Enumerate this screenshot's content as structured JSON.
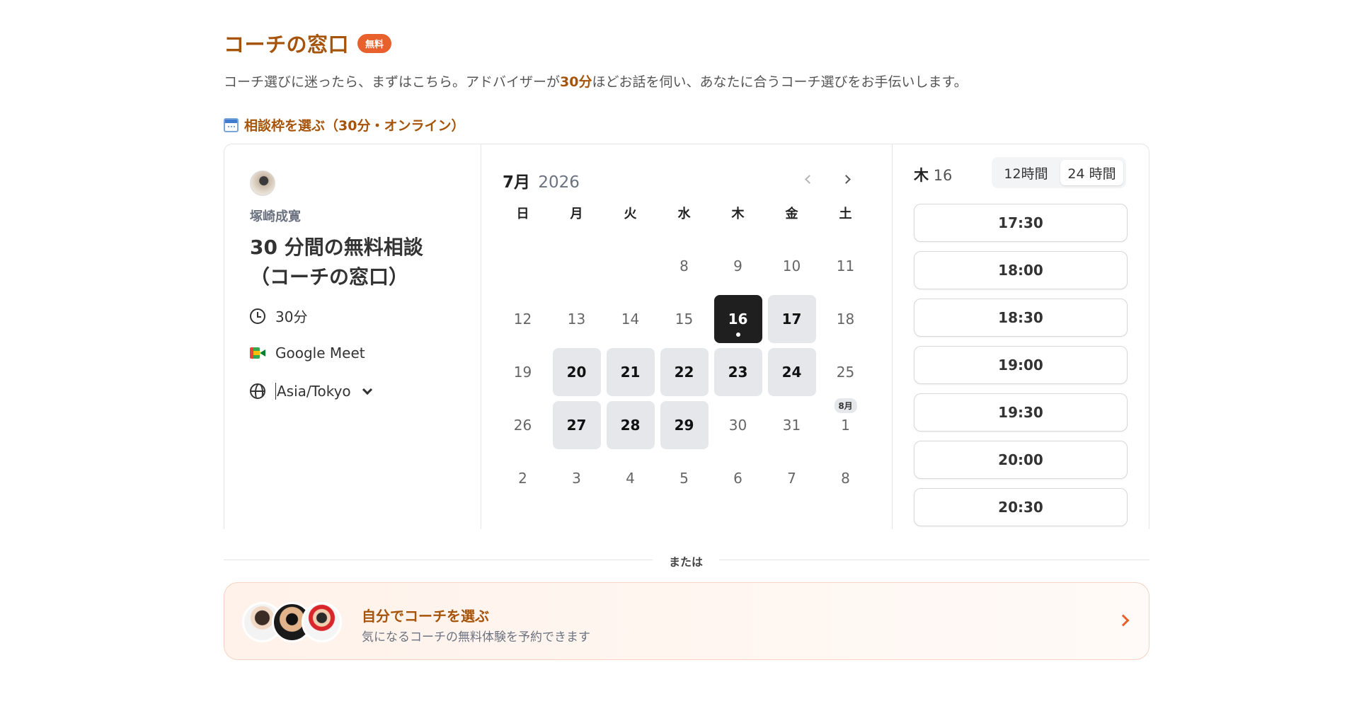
{
  "header": {
    "title": "コーチの窓口",
    "badge": "無料",
    "lead_before": "コーチ選びに迷ったら、まずはこちら。アドバイザーが",
    "lead_highlight": "30分",
    "lead_after": "ほどお話を伺い、あなたに合うコーチ選びをお手伝いします。"
  },
  "section": {
    "icon": "calendar-icon",
    "heading": "相談枠を選ぶ（30分・オンライン）"
  },
  "event": {
    "host_name": "塚崎成寛",
    "title_line1": "30 分間の無料相談",
    "title_line2": "（コーチの窓口）",
    "duration": "30分",
    "location": "Google Meet",
    "timezone": "Asia/Tokyo"
  },
  "calendar": {
    "month": "7月",
    "year": "2026",
    "weekdays": [
      "日",
      "月",
      "火",
      "水",
      "木",
      "金",
      "土"
    ],
    "weeks": [
      [
        {
          "d": ""
        },
        {
          "d": ""
        },
        {
          "d": ""
        },
        {
          "d": "8"
        },
        {
          "d": "9"
        },
        {
          "d": "10"
        },
        {
          "d": "11"
        }
      ],
      [
        {
          "d": "12"
        },
        {
          "d": "13"
        },
        {
          "d": "14"
        },
        {
          "d": "15"
        },
        {
          "d": "16",
          "state": "selected"
        },
        {
          "d": "17",
          "state": "available"
        },
        {
          "d": "18"
        }
      ],
      [
        {
          "d": "19"
        },
        {
          "d": "20",
          "state": "available"
        },
        {
          "d": "21",
          "state": "available"
        },
        {
          "d": "22",
          "state": "available"
        },
        {
          "d": "23",
          "state": "available"
        },
        {
          "d": "24",
          "state": "available"
        },
        {
          "d": "25"
        }
      ],
      [
        {
          "d": "26"
        },
        {
          "d": "27",
          "state": "available"
        },
        {
          "d": "28",
          "state": "available"
        },
        {
          "d": "29",
          "state": "available"
        },
        {
          "d": "30"
        },
        {
          "d": "31"
        },
        {
          "d": "1",
          "tag": "8月"
        }
      ],
      [
        {
          "d": "2"
        },
        {
          "d": "3"
        },
        {
          "d": "4"
        },
        {
          "d": "5"
        },
        {
          "d": "6"
        },
        {
          "d": "7"
        },
        {
          "d": "8"
        }
      ]
    ]
  },
  "times": {
    "selected_weekday": "木",
    "selected_day": "16",
    "format_12": "12時間",
    "format_24": "24 時間",
    "active_format": "24",
    "slots": [
      "17:30",
      "18:00",
      "18:30",
      "19:00",
      "19:30",
      "20:00",
      "20:30"
    ]
  },
  "divider": {
    "label": "または"
  },
  "coach_pick": {
    "title": "自分でコーチを選ぶ",
    "subtitle": "気になるコーチの無料体験を予約できます"
  },
  "colors": {
    "accent": "#a6540a",
    "badge": "#e8602c",
    "selected_day": "#1f1f1f",
    "available_day": "#e5e7eb"
  }
}
